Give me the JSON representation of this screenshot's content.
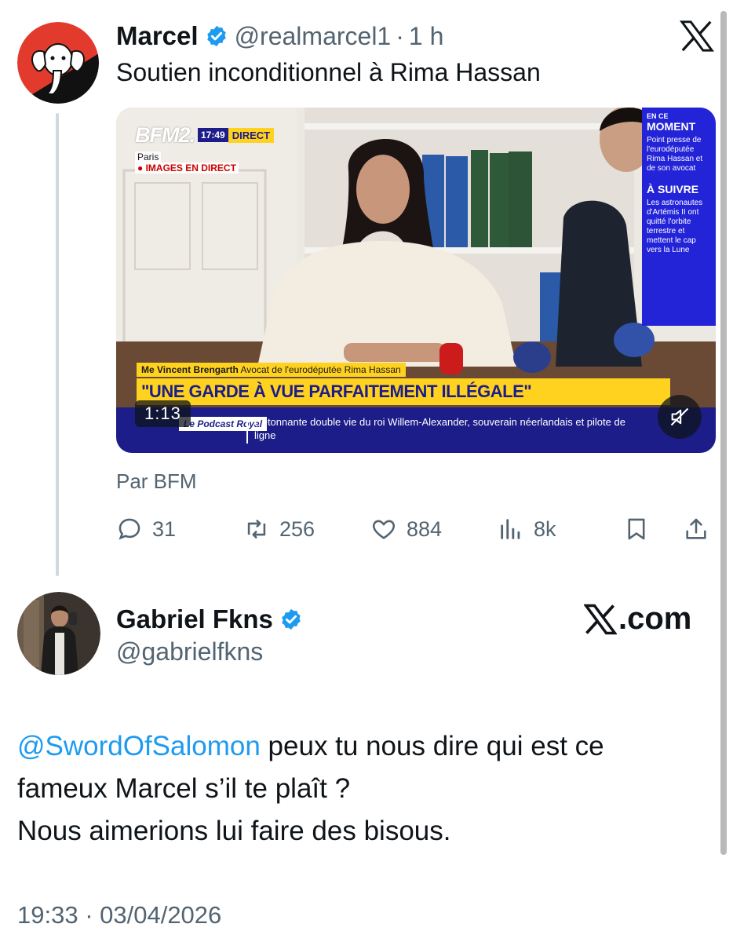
{
  "tweet1": {
    "author_name": "Marcel",
    "handle": "@realmarcel1",
    "separator": "·",
    "time": "1 h",
    "text": "Soutien inconditionnel à Rima Hassan",
    "avatar_icon": "elephant-icon",
    "video": {
      "channel_logo": "BFM2.",
      "clock": "17:49",
      "direct_label": "DIRECT",
      "location": "Paris",
      "live_label": "● IMAGES EN DIRECT",
      "side_en_ce": "EN CE",
      "side_moment": "MOMENT",
      "side_moment_body": "Point presse de l'eurodéputée Rima Hassan et de son avocat",
      "side_next": "À SUIVRE",
      "side_next_body": "Les astronautes d'Artémis II ont quitté l'orbite terrestre et mettent le cap vers la Lune",
      "lower_name": "Me Vincent Brengarth",
      "lower_role": "Avocat de l'eurodéputée Rima Hassan",
      "lower_title": "\"UNE GARDE À VUE PARFAITEMENT ILLÉGALE\"",
      "podcast_label": "Le Podcast Royal",
      "ticker": "L'étonnante double vie du roi Willem-Alexander, souverain néerlandais et pilote de ligne",
      "duration": "1:13"
    },
    "source": "Par BFM",
    "stats": {
      "replies": "31",
      "retweets": "256",
      "likes": "884",
      "views": "8k"
    }
  },
  "tweet2": {
    "author_name": "Gabriel Fkns",
    "handle": "@gabrielfkns",
    "brand": ".com",
    "mention": "@SwordOfSalomon",
    "text_line1_rest": " peux tu nous dire qui est ce",
    "text_line2": "fameux Marcel s’il te plaît ?",
    "text_line3": "Nous aimerions lui faire des bisous.",
    "timestamp": "19:33 · 03/04/2026"
  },
  "colors": {
    "accent": "#1d9bf0",
    "secondary_text": "#536471",
    "bfm_blue": "#1d1d8a",
    "bfm_yellow": "#ffd21f"
  }
}
